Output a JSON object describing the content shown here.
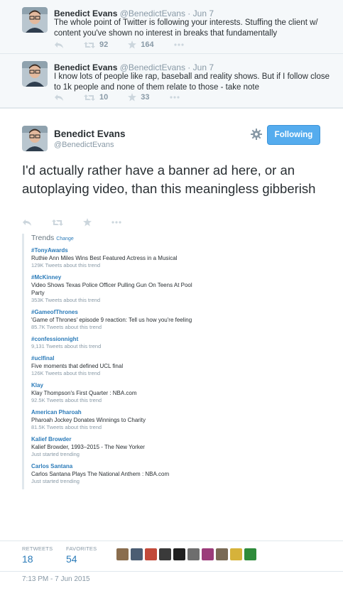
{
  "context_tweets": [
    {
      "name": "Benedict Evans",
      "handle": "@BenedictEvans",
      "sep": "·",
      "date": "Jun 7",
      "text": "The whole point of Twitter is following your interests. Stuffing the client w/ content you've shown no interest in breaks that fundamentally",
      "retweets": "92",
      "favorites": "164"
    },
    {
      "name": "Benedict Evans",
      "handle": "@BenedictEvans",
      "sep": "·",
      "date": "Jun 7",
      "text": "I know lots of people like rap, baseball and reality shows. But if I follow close to 1k people and none of them relate to those - take note",
      "retweets": "10",
      "favorites": "33"
    }
  ],
  "main_tweet": {
    "name": "Benedict Evans",
    "handle": "@BenedictEvans",
    "follow_label": "Following",
    "text": "I'd actually rather have a banner ad here, or an autoplaying video, than this meaningless gibberish"
  },
  "trends": {
    "title": "Trends",
    "change": "Change",
    "items": [
      {
        "tag": "#TonyAwards",
        "desc": "Ruthie Ann Miles Wins Best Featured Actress in a Musical",
        "count": "129K Tweets about this trend"
      },
      {
        "tag": "#McKinney",
        "desc": "Video Shows Texas Police Officer Pulling Gun On Teens At Pool Party",
        "count": "353K Tweets about this trend"
      },
      {
        "tag": "#GameofThrones",
        "desc": "'Game of Thrones' episode 9 reaction: Tell us how you're feeling",
        "count": "85.7K Tweets about this trend"
      },
      {
        "tag": "#confessionnight",
        "desc": "",
        "count": "9,131 Tweets about this trend"
      },
      {
        "tag": "#uclfinal",
        "desc": "Five moments that defined UCL final",
        "count": "126K Tweets about this trend"
      },
      {
        "tag": "Klay",
        "desc": "Klay Thompson's First Quarter : NBA.com",
        "count": "92.5K Tweets about this trend"
      },
      {
        "tag": "American Pharoah",
        "desc": "Pharoah Jockey Donates Winnings to Charity",
        "count": "81.5K Tweets about this trend"
      },
      {
        "tag": "Kalief Browder",
        "desc": "Kalief Browder, 1993–2015 - The New Yorker",
        "count": "Just started trending"
      },
      {
        "tag": "Carlos Santana",
        "desc": "Carlos Santana Plays The National Anthem : NBA.com",
        "count": "Just started trending"
      }
    ]
  },
  "stats": {
    "retweets_label": "RETWEETS",
    "retweets": "18",
    "favorites_label": "FAVORITES",
    "favorites": "54"
  },
  "favoriters": [
    "#8a6d4e",
    "#4b5d73",
    "#c24a3a",
    "#3a3a3a",
    "#1f1f1f",
    "#6e6e6e",
    "#9b3c7a",
    "#7a6a55",
    "#d6b23a",
    "#2e8b3a"
  ],
  "timestamp": "7:13 PM - 7 Jun 2015",
  "colors": {
    "link": "#2b7bb9",
    "follow_button": "#55acee",
    "muted": "#8899a6"
  }
}
